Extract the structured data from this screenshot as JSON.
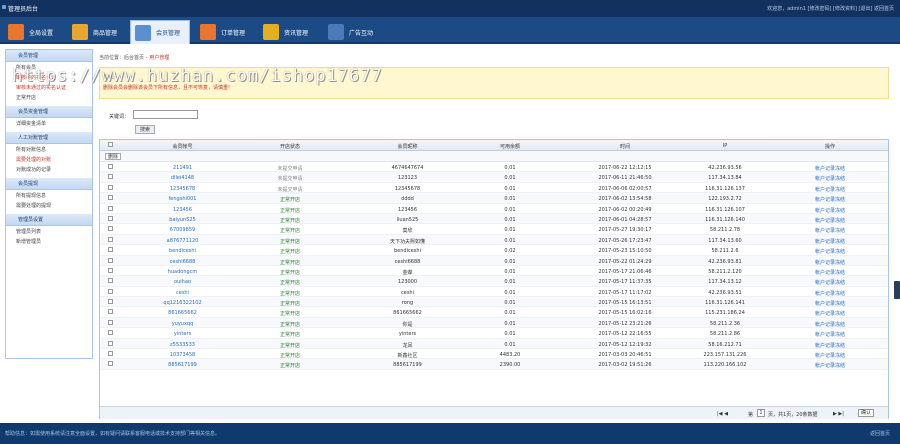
{
  "header": {
    "title": "管理员后台",
    "userinfo": "欢迎您，admin1 [修改密码]  [修改资料]  [退出]  返回首页"
  },
  "nav": {
    "tabs": [
      {
        "label": "全局设置",
        "color": "#e8762c"
      },
      {
        "label": "商品管理",
        "color": "#e8a630"
      },
      {
        "label": "会员管理",
        "color": "#5a8fd2",
        "active": true
      },
      {
        "label": "订单管理",
        "color": "#e8762c"
      },
      {
        "label": "资讯管理",
        "color": "#e2b020"
      },
      {
        "label": "广告互动",
        "color": "#4a7ab8"
      }
    ]
  },
  "sidebar": [
    {
      "group": "会员管理",
      "items": [
        {
          "label": "所有会员"
        },
        {
          "label": "审核中的实名认证",
          "red": true
        },
        {
          "label": "审核未通过的实名认证",
          "red": true
        },
        {
          "label": "正常开店"
        }
      ]
    },
    {
      "group": "会员资金管理",
      "items": [
        {
          "label": "详细资金清单"
        }
      ]
    },
    {
      "group": "人工对账管理",
      "items": [
        {
          "label": "所有对账信息"
        },
        {
          "label": "需要处理的对账",
          "red": true
        },
        {
          "label": "对账成功的记录"
        }
      ]
    },
    {
      "group": "会员提现",
      "items": [
        {
          "label": "所有提现信息"
        },
        {
          "label": "需要处理的提现"
        }
      ]
    },
    {
      "group": "管理员设置",
      "items": [
        {
          "label": "管理员列表"
        },
        {
          "label": "新增管理员"
        }
      ]
    }
  ],
  "breadcrumb": {
    "prefix": "当前位置：后台首页 -",
    "current": "用户管理"
  },
  "tip": {
    "title": "提示:",
    "text": "删除会员会删除该会员下所有信息，且不可恢复，请慎重!"
  },
  "watermark": "https://www.huzhan.com/ishop17677",
  "search": {
    "label": "关键词：",
    "value": "",
    "button": "搜索"
  },
  "table": {
    "columns": [
      "会员帐号",
      "开店状态",
      "会员昵称",
      "可用余额",
      "时间",
      "IP",
      "操作"
    ],
    "delete_label": "删除",
    "rows": [
      [
        "211491",
        "未提交申请",
        "4674647674",
        "0.01",
        "2017-06-22 12:12:15",
        "42.236.93.56",
        "帐户记录冻结"
      ],
      [
        "dilei4148",
        "未提交申请",
        "123123",
        "0.01",
        "2017-06-11 21:46:50",
        "117.34.13.84",
        "帐户记录冻结"
      ],
      [
        "12345678",
        "未提交申请",
        "12345678",
        "0.01",
        "2017-06-06 02:00:57",
        "116.31.126.137",
        "帐户记录冻结"
      ],
      [
        "fengshi001",
        "正常开店",
        "dddd",
        "0.01",
        "2017-06-02 13:54:58",
        "122.193.2.72",
        "帐户记录冻结"
      ],
      [
        "123456",
        "正常开店",
        "123456",
        "0.01",
        "2017-06-02 00:20:49",
        "116.31.126.107",
        "帐户记录冻结"
      ],
      [
        "baiyun525",
        "正常开店",
        "liuan525",
        "0.01",
        "2017-06-01 04:28:57",
        "116.31.126.140",
        "帐户记录冻结"
      ],
      [
        "67009859",
        "正常开店",
        "莫欣",
        "0.01",
        "2017-05-27 19:30:17",
        "58.211.2.78",
        "帐户记录冻结"
      ],
      [
        "a876771120",
        "正常开店",
        "天下功夫熙如懂",
        "0.01",
        "2017-05-26 17:23:47",
        "117.34.13.60",
        "帐户记录冻结"
      ],
      [
        "bendiceshi",
        "正常开店",
        "bendiceshi",
        "0.02",
        "2017-05-23 15:10:50",
        "58.211.2.6",
        "帐户记录冻结"
      ],
      [
        "ceshi6688",
        "正常开店",
        "ceshi6688",
        "0.01",
        "2017-05-22 01:24:29",
        "42.236.93.81",
        "帐户记录冻结"
      ],
      [
        "huadongcm",
        "正常开店",
        "金蝶",
        "0.01",
        "2017-05-17 21:06:46",
        "58.211.2.120",
        "帐户记录冻结"
      ],
      [
        "ouihao",
        "正常开店",
        "123000",
        "0.01",
        "2017-05-17 11:37:35",
        "117.34.13.12",
        "帐户记录冻结"
      ],
      [
        "ceshi",
        "正常开店",
        "ceshi",
        "0.01",
        "2017-05-17 11:17:02",
        "42.236.93.51",
        "帐户记录冻结"
      ],
      [
        "qq1216322102",
        "正常开店",
        "rong",
        "0.01",
        "2017-05-15 16:13:51",
        "116.31.126.141",
        "帐户记录冻结"
      ],
      [
        "861665662",
        "正常开店",
        "861665662",
        "0.01",
        "2017-05-15 16:02:16",
        "115.231.186.24",
        "帐户记录冻结"
      ],
      [
        "yuyuxqq",
        "正常开店",
        "你是",
        "0.01",
        "2017-05-12 23:21:26",
        "58.211.2.36",
        "帐户记录冻结"
      ],
      [
        "yinters",
        "正常开店",
        "yinters",
        "0.01",
        "2017-05-12 22:16:55",
        "58.211.2.86",
        "帐户记录冻结"
      ],
      [
        "z5533533",
        "正常开店",
        "龙凤",
        "0.01",
        "2017-05-12 12:19:32",
        "58.16.212.71",
        "帐户记录冻结"
      ],
      [
        "10373458",
        "正常开店",
        "新鑫社区",
        "4483.20",
        "2017-03-03 20:46:51",
        "223.157.131.226",
        "帐户记录冻结"
      ],
      [
        "885617199",
        "正常开店",
        "885617199",
        "2390.00",
        "2017-03-02 19:51:26",
        "113.220.166.102",
        "帐户记录冻结"
      ]
    ]
  },
  "pager": {
    "page_label": "第",
    "page": "1",
    "total": "页，共1页，20条数据",
    "button": "确认"
  },
  "footer": {
    "left": "帮助信息：如需使用系统请注意全面设置，如有疑问请联系客服电话或技术支持部门等相关信息。",
    "right": "返回首页"
  }
}
